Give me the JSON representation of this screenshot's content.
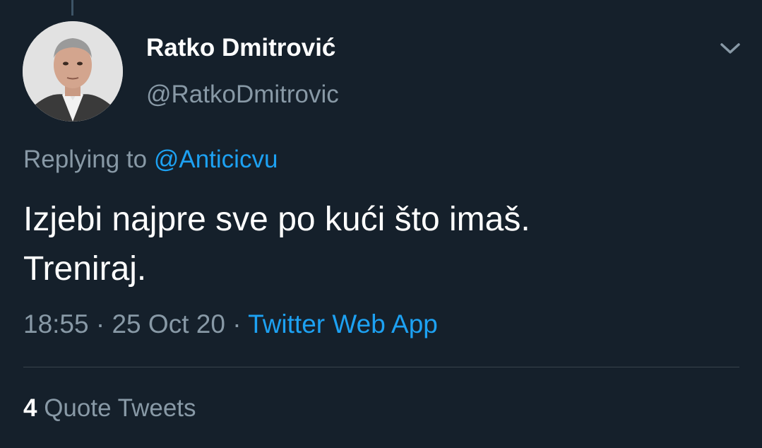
{
  "author": {
    "display_name": "Ratko Dmitrović",
    "handle": "@RatkoDmitrovic",
    "avatar": "profile-photo"
  },
  "menu_icon": "chevron-down-icon",
  "reply": {
    "prefix": "Replying to",
    "mention": "@Anticicvu"
  },
  "tweet": {
    "lines": [
      "Izjebi najpre sve po kući što imaš.",
      "Treniraj."
    ]
  },
  "meta": {
    "time": "18:55",
    "sep1": "·",
    "date": "25 Oct 20",
    "sep2": "·",
    "source": "Twitter Web App"
  },
  "stats": {
    "quote_count": "4",
    "quote_label": "Quote Tweets"
  },
  "colors": {
    "background": "#15202b",
    "text": "#ffffff",
    "secondary": "#8899a6",
    "accent": "#1da1f2",
    "divider": "#38444d"
  }
}
